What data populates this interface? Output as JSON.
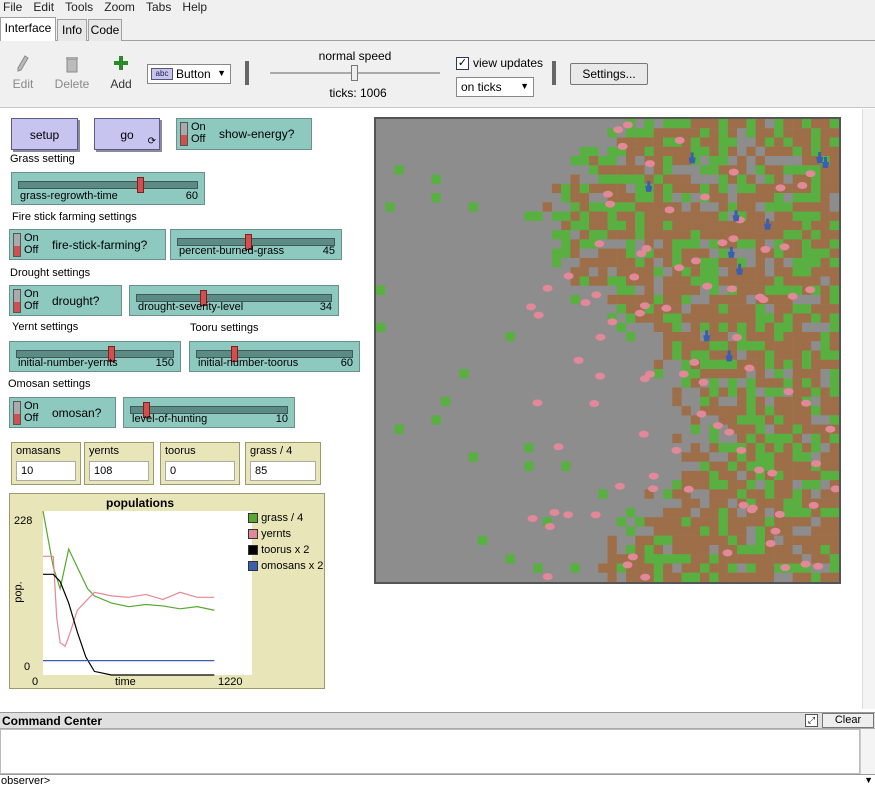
{
  "menu": [
    "File",
    "Edit",
    "Tools",
    "Zoom",
    "Tabs",
    "Help"
  ],
  "tabs": [
    "Interface",
    "Info",
    "Code"
  ],
  "toolbar": {
    "edit": "Edit",
    "delete": "Delete",
    "add": "Add",
    "widget_type": "Button",
    "speed_label": "normal speed",
    "ticks": "ticks: 1006",
    "view_updates": "view updates",
    "update_mode": "on ticks",
    "settings": "Settings..."
  },
  "buttons": {
    "setup": "setup",
    "go": "go"
  },
  "switch_labels": {
    "on": "On",
    "off": "Off"
  },
  "switches": {
    "show_energy": "show-energy?",
    "fire_stick": "fire-stick-farming?",
    "drought": "drought?",
    "omosan": "omosan?"
  },
  "sections": {
    "grass": "Grass setting",
    "fire": "Fire stick farming settings",
    "drought": "Drought settings",
    "yernt": "Yernt settings",
    "tooru": "Tooru settings",
    "omosan": "Omosan settings"
  },
  "sliders": [
    {
      "name": "grass-regrowth-time",
      "value": "60",
      "fraction": 0.68
    },
    {
      "name": "percent-burned-grass",
      "value": "45",
      "fraction": 0.45
    },
    {
      "name": "drought-severity-level",
      "value": "34",
      "fraction": 0.34
    },
    {
      "name": "initial-number-yernts",
      "value": "150",
      "fraction": 0.6
    },
    {
      "name": "initial-number-toorus",
      "value": "60",
      "fraction": 0.24
    },
    {
      "name": "level-of-hunting",
      "value": "10",
      "fraction": 0.1
    }
  ],
  "monitors": [
    {
      "label": "omasans",
      "value": "10"
    },
    {
      "label": "yernts",
      "value": "108"
    },
    {
      "label": "toorus",
      "value": "0"
    },
    {
      "label": "grass / 4",
      "value": "85"
    }
  ],
  "chart_data": {
    "type": "line",
    "title": "populations",
    "xlabel": "time",
    "ylabel": "pop.",
    "xlim": [
      0,
      1220
    ],
    "ylim": [
      0,
      228
    ],
    "legend": "right",
    "series": [
      {
        "name": "grass / 4",
        "color": "#58a832",
        "x": [
          0,
          60,
          100,
          150,
          200,
          260,
          300,
          400,
          500,
          600,
          700,
          800,
          900,
          1000
        ],
        "y": [
          228,
          150,
          120,
          175,
          150,
          120,
          110,
          100,
          95,
          98,
          96,
          92,
          95,
          90
        ]
      },
      {
        "name": "yernts",
        "color": "#e38898",
        "x": [
          0,
          60,
          80,
          100,
          130,
          160,
          200,
          260,
          300,
          400,
          500,
          600,
          700,
          800,
          900,
          1000
        ],
        "y": [
          165,
          165,
          80,
          45,
          40,
          60,
          90,
          105,
          115,
          110,
          108,
          112,
          105,
          115,
          108,
          108
        ]
      },
      {
        "name": "toorus x 2",
        "color": "#000000",
        "x": [
          0,
          60,
          100,
          150,
          200,
          250,
          300,
          400,
          600,
          800,
          1000
        ],
        "y": [
          140,
          140,
          130,
          100,
          60,
          25,
          5,
          0,
          0,
          0,
          0
        ]
      },
      {
        "name": "omosans x 2",
        "color": "#3a5fb0",
        "x": [
          0,
          1000
        ],
        "y": [
          20,
          20
        ]
      }
    ],
    "ytick_labels": [
      "228",
      "0"
    ],
    "xtick_labels": [
      "0",
      "1220"
    ]
  },
  "command_center": {
    "title": "Command Center",
    "clear": "Clear",
    "prompt": "observer>"
  },
  "colors": {
    "patch_gray": "#8d8d8d",
    "patch_green": "#58b040",
    "patch_brown": "#9d6e48",
    "yernt": "#e38898",
    "omosan": "#3a5fb0"
  }
}
